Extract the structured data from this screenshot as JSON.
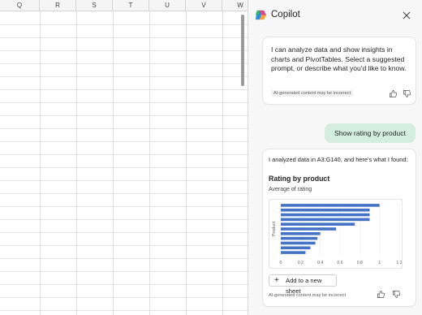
{
  "sheet": {
    "columns": [
      "Q",
      "R",
      "S",
      "T",
      "U",
      "V",
      "W"
    ]
  },
  "copilot": {
    "title": "Copilot",
    "intro_message": "I can analyze data and show insights in charts and PivotTables. Select a suggested prompt, or describe what you'd like to know.",
    "disclaimer": "AI-generated content may be incorrect",
    "user_prompt": "Show rating by product",
    "response": {
      "intro": "I analyzed data in A3:G140, and here's what I found:",
      "chart_title": "Rating by product",
      "chart_subtitle": "Average of rating",
      "add_button": "Add to a new sheet",
      "disclaimer": "AI-generated content may be incorrect"
    }
  },
  "chart_data": {
    "type": "bar",
    "orientation": "horizontal",
    "title": "Rating by product",
    "subtitle": "Average of rating",
    "xlabel": "",
    "ylabel": "Product",
    "xlim": [
      0,
      1.2
    ],
    "xticks": [
      "0",
      "0.2",
      "0.4",
      "0.6",
      "0.8",
      "1",
      "1.2"
    ],
    "values": [
      1.0,
      0.9,
      0.9,
      0.9,
      0.75,
      0.56,
      0.4,
      0.37,
      0.35,
      0.3,
      0.25
    ],
    "color": "#4472c4",
    "grid": true
  },
  "colors": {
    "accent": "#d3eede",
    "bar": "#4472c4"
  }
}
